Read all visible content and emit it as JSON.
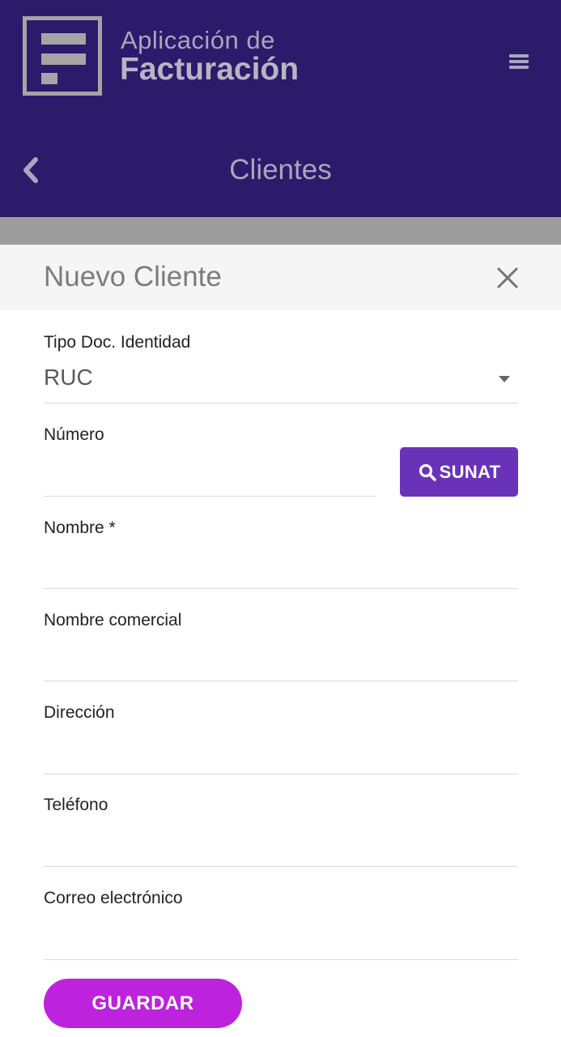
{
  "header": {
    "app_name_line1": "Aplicación de",
    "app_name_line2": "Facturación",
    "page_title": "Clientes",
    "menu_icon": "hamburger-menu-icon",
    "back_icon": "chevron-left-icon",
    "logo_icon": "letter-f-logo"
  },
  "modal": {
    "title": "Nuevo Cliente",
    "close_icon": "close-icon"
  },
  "form": {
    "doc_type": {
      "label": "Tipo Doc. Identidad",
      "selected": "RUC"
    },
    "numero": {
      "label": "Número",
      "value": ""
    },
    "sunat_button": {
      "label": "SUNAT",
      "icon": "search-icon"
    },
    "nombre": {
      "label": "Nombre *",
      "value": ""
    },
    "nombre_comercial": {
      "label": "Nombre comercial",
      "value": ""
    },
    "direccion": {
      "label": "Dirección",
      "value": ""
    },
    "telefono": {
      "label": "Teléfono",
      "value": ""
    },
    "correo": {
      "label": "Correo electrónico",
      "value": ""
    },
    "save_button": "GUARDAR"
  },
  "colors": {
    "header_bg": "#2b1b6b",
    "sunat_button": "#6a32b8",
    "save_button": "#bd22dd",
    "modal_header_bg": "#f5f5f5",
    "band": "#9d9d9d"
  }
}
